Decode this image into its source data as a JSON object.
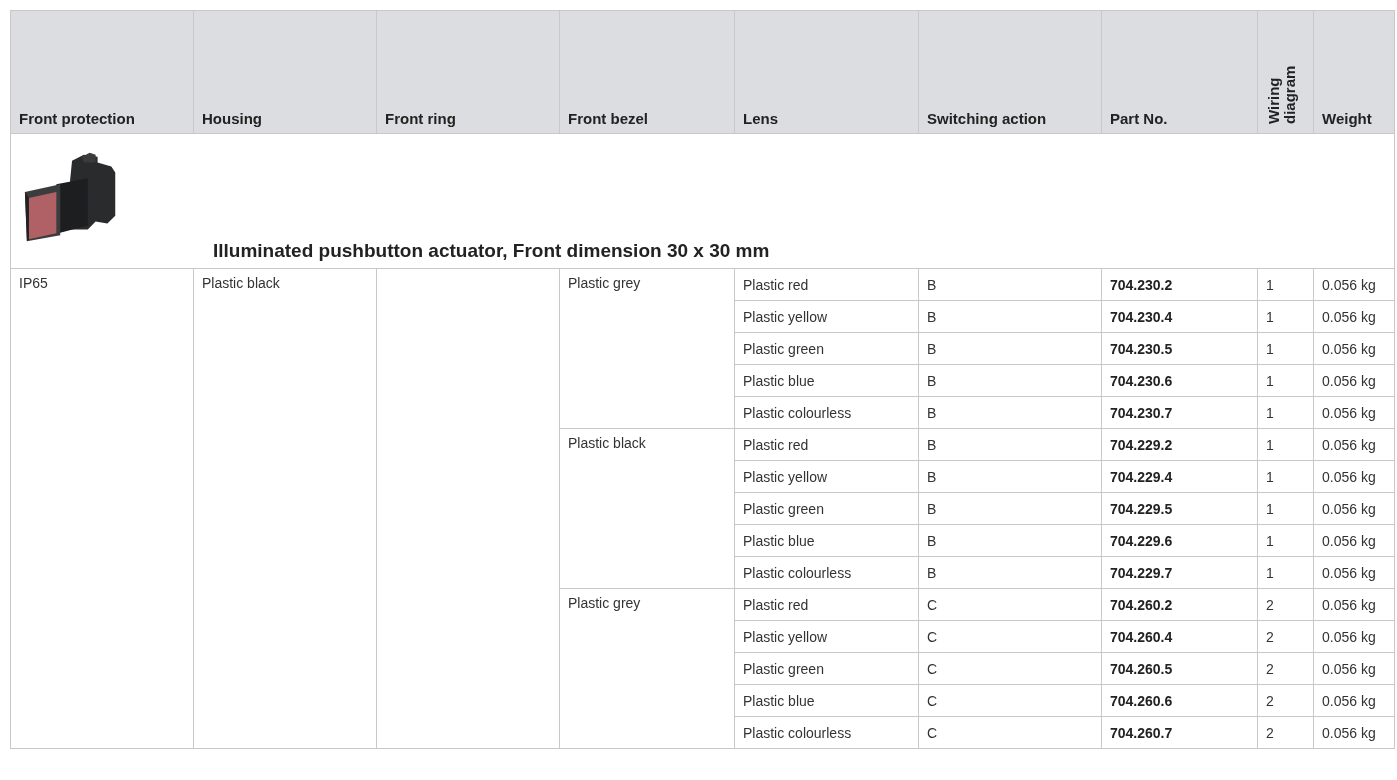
{
  "table": {
    "columns": [
      {
        "label": "Front protection",
        "vertical": false
      },
      {
        "label": "Housing",
        "vertical": false
      },
      {
        "label": "Front ring",
        "vertical": false
      },
      {
        "label": "Front bezel",
        "vertical": false
      },
      {
        "label": "Lens",
        "vertical": false
      },
      {
        "label": "Switching action",
        "vertical": false
      },
      {
        "label": "Part No.",
        "vertical": false
      },
      {
        "label": "Wiring diagram",
        "vertical": true
      },
      {
        "label": "Weight",
        "vertical": false
      }
    ],
    "section_title": "Illuminated pushbutton actuator, Front dimension 30 x 30 mm",
    "front_protection": "IP65",
    "housing": "Plastic black",
    "bezel_groups": [
      {
        "front_bezel": "Plastic grey",
        "rows": [
          {
            "lens": "Plastic red",
            "switching_action": "B",
            "part_no": "704.230.2",
            "wiring_diagram": "1",
            "weight": "0.056 kg"
          },
          {
            "lens": "Plastic yellow",
            "switching_action": "B",
            "part_no": "704.230.4",
            "wiring_diagram": "1",
            "weight": "0.056 kg"
          },
          {
            "lens": "Plastic green",
            "switching_action": "B",
            "part_no": "704.230.5",
            "wiring_diagram": "1",
            "weight": "0.056 kg"
          },
          {
            "lens": "Plastic blue",
            "switching_action": "B",
            "part_no": "704.230.6",
            "wiring_diagram": "1",
            "weight": "0.056 kg"
          },
          {
            "lens": "Plastic colourless",
            "switching_action": "B",
            "part_no": "704.230.7",
            "wiring_diagram": "1",
            "weight": "0.056 kg"
          }
        ]
      },
      {
        "front_bezel": "Plastic black",
        "rows": [
          {
            "lens": "Plastic red",
            "switching_action": "B",
            "part_no": "704.229.2",
            "wiring_diagram": "1",
            "weight": "0.056 kg"
          },
          {
            "lens": "Plastic yellow",
            "switching_action": "B",
            "part_no": "704.229.4",
            "wiring_diagram": "1",
            "weight": "0.056 kg"
          },
          {
            "lens": "Plastic green",
            "switching_action": "B",
            "part_no": "704.229.5",
            "wiring_diagram": "1",
            "weight": "0.056 kg"
          },
          {
            "lens": "Plastic blue",
            "switching_action": "B",
            "part_no": "704.229.6",
            "wiring_diagram": "1",
            "weight": "0.056 kg"
          },
          {
            "lens": "Plastic colourless",
            "switching_action": "B",
            "part_no": "704.229.7",
            "wiring_diagram": "1",
            "weight": "0.056 kg"
          }
        ]
      },
      {
        "front_bezel": "Plastic grey",
        "rows": [
          {
            "lens": "Plastic red",
            "switching_action": "C",
            "part_no": "704.260.2",
            "wiring_diagram": "2",
            "weight": "0.056 kg"
          },
          {
            "lens": "Plastic yellow",
            "switching_action": "C",
            "part_no": "704.260.4",
            "wiring_diagram": "2",
            "weight": "0.056 kg"
          },
          {
            "lens": "Plastic green",
            "switching_action": "C",
            "part_no": "704.260.5",
            "wiring_diagram": "2",
            "weight": "0.056 kg"
          },
          {
            "lens": "Plastic blue",
            "switching_action": "C",
            "part_no": "704.260.6",
            "wiring_diagram": "2",
            "weight": "0.056 kg"
          },
          {
            "lens": "Plastic colourless",
            "switching_action": "C",
            "part_no": "704.260.7",
            "wiring_diagram": "2",
            "weight": "0.056 kg"
          }
        ]
      }
    ]
  }
}
